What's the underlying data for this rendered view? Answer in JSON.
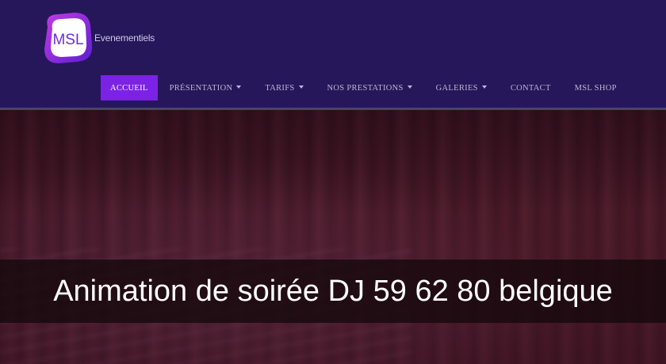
{
  "brand": {
    "logo_text": "MSL",
    "tagline": "Evenementiels",
    "colors": {
      "ring": "#a52ee0",
      "ring_dark": "#5a1fcf",
      "text": "#6b2fd6"
    }
  },
  "nav": {
    "items": [
      {
        "label": "ACCUEIL",
        "active": true,
        "dropdown": false
      },
      {
        "label": "PRÉSENTATION",
        "active": false,
        "dropdown": true
      },
      {
        "label": "TARIFS",
        "active": false,
        "dropdown": true
      },
      {
        "label": "NOS PRESTATIONS",
        "active": false,
        "dropdown": true
      },
      {
        "label": "GALERIES",
        "active": false,
        "dropdown": true
      },
      {
        "label": "CONTACT",
        "active": false,
        "dropdown": false
      },
      {
        "label": "MSL SHOP",
        "active": false,
        "dropdown": false
      }
    ],
    "active_color": "#7c22e6"
  },
  "hero": {
    "title": "Animation de soirée DJ 59 62 80 belgique"
  },
  "colors": {
    "header_bg": "#25175a",
    "hero_bg": "#3a1420"
  }
}
